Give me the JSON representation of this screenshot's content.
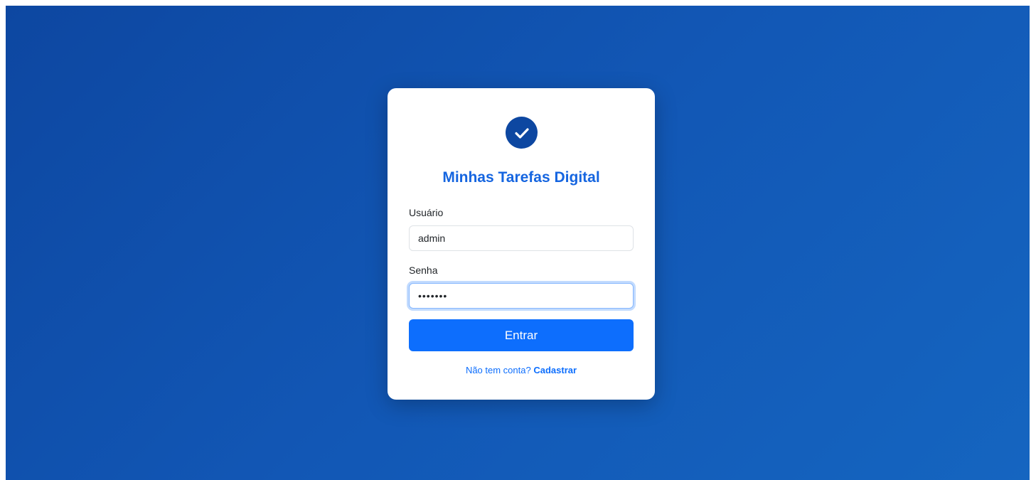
{
  "app": {
    "title": "Minhas Tarefas Digital",
    "logo_icon": "check-circle-icon"
  },
  "form": {
    "username_label": "Usuário",
    "username_value": "admin",
    "password_label": "Senha",
    "password_value": "•••••••",
    "submit_label": "Entrar"
  },
  "signup": {
    "prompt": "Não tem conta?",
    "link_label": "Cadastrar"
  },
  "colors": {
    "background_start": "#0d47a1",
    "background_end": "#1565c0",
    "primary": "#0d6efd",
    "logo": "#0d47a1"
  }
}
